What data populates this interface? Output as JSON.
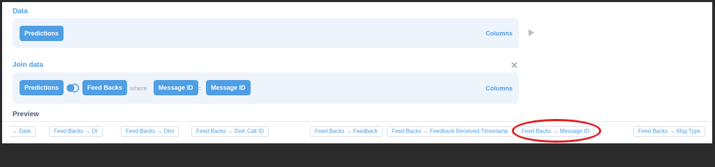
{
  "data_section": {
    "title": "Data",
    "table_chip": "Predictions",
    "columns_link": "Columns"
  },
  "join_section": {
    "title": "Join data",
    "left_table": "Predictions",
    "right_table": "Feed Backs",
    "where_label": "where",
    "left_column": "Message ID",
    "operator": "=",
    "right_column": "Message ID",
    "columns_link": "Columns"
  },
  "preview": {
    "title": "Preview",
    "columns": [
      "→ Date",
      "Feed Backs → Dt",
      "Feed Backs → Dtm",
      "Feed Backs → Dwh Call ID",
      "Feed Backs → Feedback",
      "Feed Backs → Feedback Received Timestamp",
      "Feed Backs → Message ID",
      "Feed Backs → Msg Type"
    ]
  },
  "colors": {
    "accent": "#509ee3",
    "panel": "#eef4fb",
    "annotation": "#e11c23"
  },
  "icons": {
    "run": "play-icon",
    "join_type": "left-join-icon",
    "remove": "close-icon"
  }
}
